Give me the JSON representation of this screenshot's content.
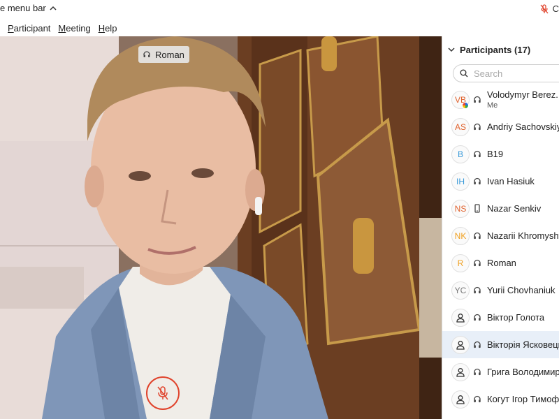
{
  "titlebar": {
    "menubar_toggle_label": "e menu bar",
    "recording_label": "C"
  },
  "menu": [
    "Participant",
    "Meeting",
    "Help"
  ],
  "video": {
    "speaker_name": "Roman"
  },
  "panel": {
    "title": "Participants (17)",
    "search_placeholder": "Search"
  },
  "participants": [
    {
      "initials": "VB",
      "color": "#e0612c",
      "name": "Volodymyr Berez...",
      "sub": "Me",
      "device": "headset",
      "avatar": "initials"
    },
    {
      "initials": "AS",
      "color": "#e0612c",
      "name": "Andriy Sachovskiy",
      "sub": "",
      "device": "headset",
      "avatar": "initials"
    },
    {
      "initials": "B",
      "color": "#3a9ad9",
      "name": "B19",
      "sub": "",
      "device": "headset",
      "avatar": "initials"
    },
    {
      "initials": "IH",
      "color": "#3a9ad9",
      "name": "Ivan Hasiuk",
      "sub": "",
      "device": "headset",
      "avatar": "initials"
    },
    {
      "initials": "NS",
      "color": "#e0612c",
      "name": "Nazar Senkiv",
      "sub": "",
      "device": "phone",
      "avatar": "initials"
    },
    {
      "initials": "NK",
      "color": "#f0a020",
      "name": "Nazarii Khromyshyn",
      "sub": "",
      "device": "headset",
      "avatar": "initials"
    },
    {
      "initials": "R",
      "color": "#f0a020",
      "name": "Roman",
      "sub": "",
      "device": "headset",
      "avatar": "initials"
    },
    {
      "initials": "YC",
      "color": "#777777",
      "name": "Yurii Chovhaniuk",
      "sub": "",
      "device": "headset",
      "avatar": "initials"
    },
    {
      "initials": "",
      "color": "#555555",
      "name": "Віктор Голота",
      "sub": "",
      "device": "headset",
      "avatar": "person"
    },
    {
      "initials": "",
      "color": "#555555",
      "name": "Вікторія Ясковець",
      "sub": "",
      "device": "headset",
      "avatar": "person",
      "selected": true
    },
    {
      "initials": "",
      "color": "#555555",
      "name": "Грига Володимир",
      "sub": "",
      "device": "headset",
      "avatar": "person"
    },
    {
      "initials": "",
      "color": "#555555",
      "name": "Когут Ігор Тимофій",
      "sub": "",
      "device": "headset",
      "avatar": "person"
    }
  ],
  "colors": {
    "accent": "#1a73e8",
    "mute_red": "#e0432c",
    "selected_row": "#e8eff8"
  }
}
